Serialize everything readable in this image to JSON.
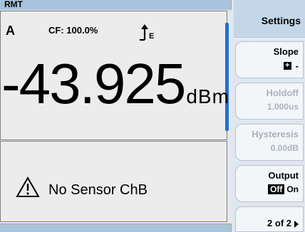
{
  "status": {
    "mode": "RMT"
  },
  "measurement": {
    "channel": "A",
    "cal_factor": "CF: 100.0%",
    "trigger_marker": "E",
    "value": "-43.925",
    "unit": "dBm"
  },
  "lower_window": {
    "message": "No Sensor ChB",
    "icon": "warning-triangle-icon"
  },
  "menu": {
    "title": "Settings",
    "slope": {
      "label": "Slope",
      "positive_symbol": "+",
      "negative_symbol": "-",
      "selected": "+"
    },
    "holdoff": {
      "label": "Holdoff",
      "value": "1.000us",
      "enabled": false
    },
    "hysteresis": {
      "label": "Hysteresis",
      "value": "0.00dB",
      "enabled": false
    },
    "output": {
      "label": "Output",
      "off_label": "Off",
      "on_label": "On",
      "selected": "Off"
    },
    "page": {
      "label": "2 of 2"
    }
  },
  "colors": {
    "accent": "#1f6fd1",
    "strip": "#a9c3dc",
    "disabled_text": "#aab2ba"
  }
}
